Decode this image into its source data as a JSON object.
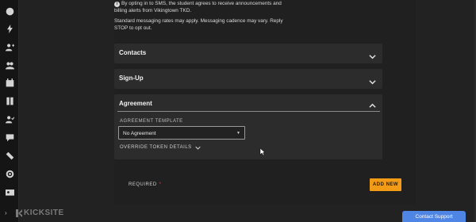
{
  "nav": {
    "items": [
      {
        "name": "dashboard-icon"
      },
      {
        "name": "lightning-icon"
      },
      {
        "name": "add-user-icon"
      },
      {
        "name": "users-icon"
      },
      {
        "name": "calendar-icon"
      },
      {
        "name": "book-icon"
      },
      {
        "name": "user-check-icon"
      },
      {
        "name": "chat-icon"
      },
      {
        "name": "ticket-icon"
      },
      {
        "name": "target-icon"
      },
      {
        "name": "id-card-icon"
      }
    ],
    "expand_glyph": "›"
  },
  "sms_note": {
    "consent_text": "By opting in to SMS, the student agrees to receive announcements and billing alerts from Vikingtown TKD.",
    "rates_text": "Standard messaging rates may apply. Messaging cadence may vary. Reply STOP to opt out."
  },
  "sections": {
    "contacts": "Contacts",
    "signup": "Sign-Up",
    "agreement": "Agreement"
  },
  "agreement": {
    "template_label": "AGREEMENT TEMPLATE",
    "template_value": "No Agreement",
    "override_label": "OVERRIDE TOKEN DETAILS"
  },
  "footer": {
    "required_label": "REQUIRED",
    "required_marker": "*",
    "add_new_label": "ADD NEW"
  },
  "brand": {
    "name": "KICKSITE"
  },
  "support": {
    "label": "Contact Support"
  },
  "colors": {
    "accent": "#f29b16",
    "support": "#4f86e6",
    "required": "#e53935"
  }
}
